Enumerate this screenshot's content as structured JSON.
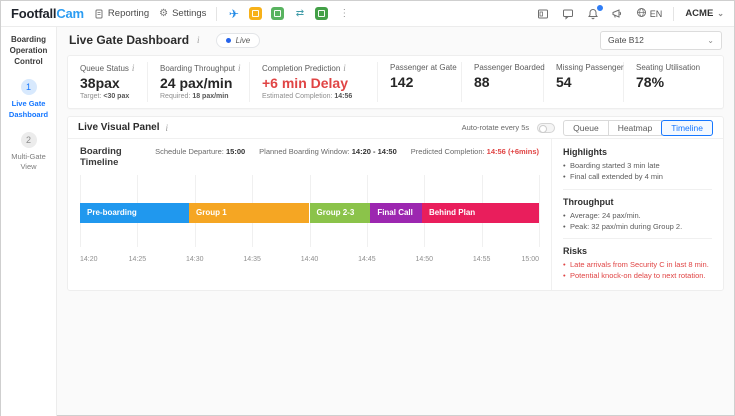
{
  "topbar": {
    "brand": {
      "part1": "Footfall",
      "part2": "Cam"
    },
    "nav": [
      {
        "label": "Reporting"
      },
      {
        "label": "Settings"
      }
    ],
    "app_icons": [
      "airplane-icon",
      "orange-doc-icon",
      "green-chart-icon",
      "transfer-icon",
      "green-calendar-icon",
      "more-dots-icon"
    ],
    "right_icons": [
      "kiosk-icon",
      "chat-icon",
      "bell-icon-with-badge",
      "megaphone-icon",
      "globe-icon"
    ],
    "language": "EN",
    "account": "ACME"
  },
  "sidebar": {
    "title": "Boarding Operation Control",
    "items": [
      {
        "step": "1",
        "label": "Live Gate Dashboard",
        "active": true
      },
      {
        "step": "2",
        "label": "Multi-Gate View",
        "active": false
      }
    ]
  },
  "header": {
    "title": "Live Gate Dashboard",
    "live_label": "Live",
    "gate_select": "Gate B12"
  },
  "kpis": [
    {
      "label": "Queue Status",
      "value": "38pax",
      "sub_label": "Target:",
      "sub_value": "<30 pax"
    },
    {
      "label": "Boarding Throughput",
      "value": "24 pax/min",
      "sub_label": "Required:",
      "sub_value": "18 pax/min"
    },
    {
      "label": "Completion Prediction",
      "value": "+6 min Delay",
      "value_color": "#e04444",
      "sub_label": "Estimated Completion:",
      "sub_value": "14:56"
    },
    {
      "label": "Passenger at Gate",
      "value": "142"
    },
    {
      "label": "Passenger Boarded",
      "value": "88"
    },
    {
      "label": "Missing Passenger",
      "value": "54"
    },
    {
      "label": "Seating Utilisation",
      "value": "78%"
    }
  ],
  "panel": {
    "title": "Live Visual Panel",
    "auto_rotate_label": "Auto-rotate every 5s",
    "view_buttons": [
      {
        "label": "Queue",
        "active": false
      },
      {
        "label": "Heatmap",
        "active": false
      },
      {
        "label": "Timeline",
        "active": true
      }
    ]
  },
  "chart_data": {
    "type": "timeline",
    "title": "Boarding Timeline",
    "meta": [
      {
        "label": "Schedule Departure:",
        "value": "15:00"
      },
      {
        "label": "Planned Boarding Window:",
        "value": "14:20 - 14:50"
      },
      {
        "label": "Predicted Completion:",
        "value": "14:56 (+6mins)",
        "value_color": "#e04444"
      }
    ],
    "axis": {
      "start": "14:20",
      "end": "15:00",
      "ticks": [
        "14:20",
        "14:25",
        "14:30",
        "14:35",
        "14:40",
        "14:45",
        "14:50",
        "14:55",
        "15:00"
      ]
    },
    "duration_min": 40,
    "segments": [
      {
        "label": "Pre-boarding",
        "start": "14:20",
        "end": "14:29",
        "start_min": 0,
        "end_min": 9.5,
        "color": "#2098ee"
      },
      {
        "label": "Group 1",
        "start": "14:29",
        "end": "14:40",
        "start_min": 9.5,
        "end_min": 20,
        "color": "#f5a623"
      },
      {
        "label": "Group 2-3",
        "start": "14:40",
        "end": "14:45",
        "start_min": 20,
        "end_min": 25.3,
        "color": "#8bc34a"
      },
      {
        "label": "Final Call",
        "start": "14:45",
        "end": "14:50",
        "start_min": 25.3,
        "end_min": 29.8,
        "color": "#9c27b0"
      },
      {
        "label": "Behind Plan",
        "start": "14:50",
        "end": "15:00",
        "start_min": 29.8,
        "end_min": 40,
        "color": "#e91e5c"
      }
    ]
  },
  "insights": {
    "sections": [
      {
        "title": "Highlights",
        "items": [
          "Boarding started 3 min late",
          "Final call extended by 4 min"
        ]
      },
      {
        "title": "Throughput",
        "items": [
          "Average: 24 pax/min.",
          "Peak: 32 pax/min during Group 2."
        ]
      },
      {
        "title": "Risks",
        "items": [
          "Late arrivals from Security C in last 8 min.",
          "Potential knock-on delay to next rotation."
        ]
      }
    ]
  }
}
